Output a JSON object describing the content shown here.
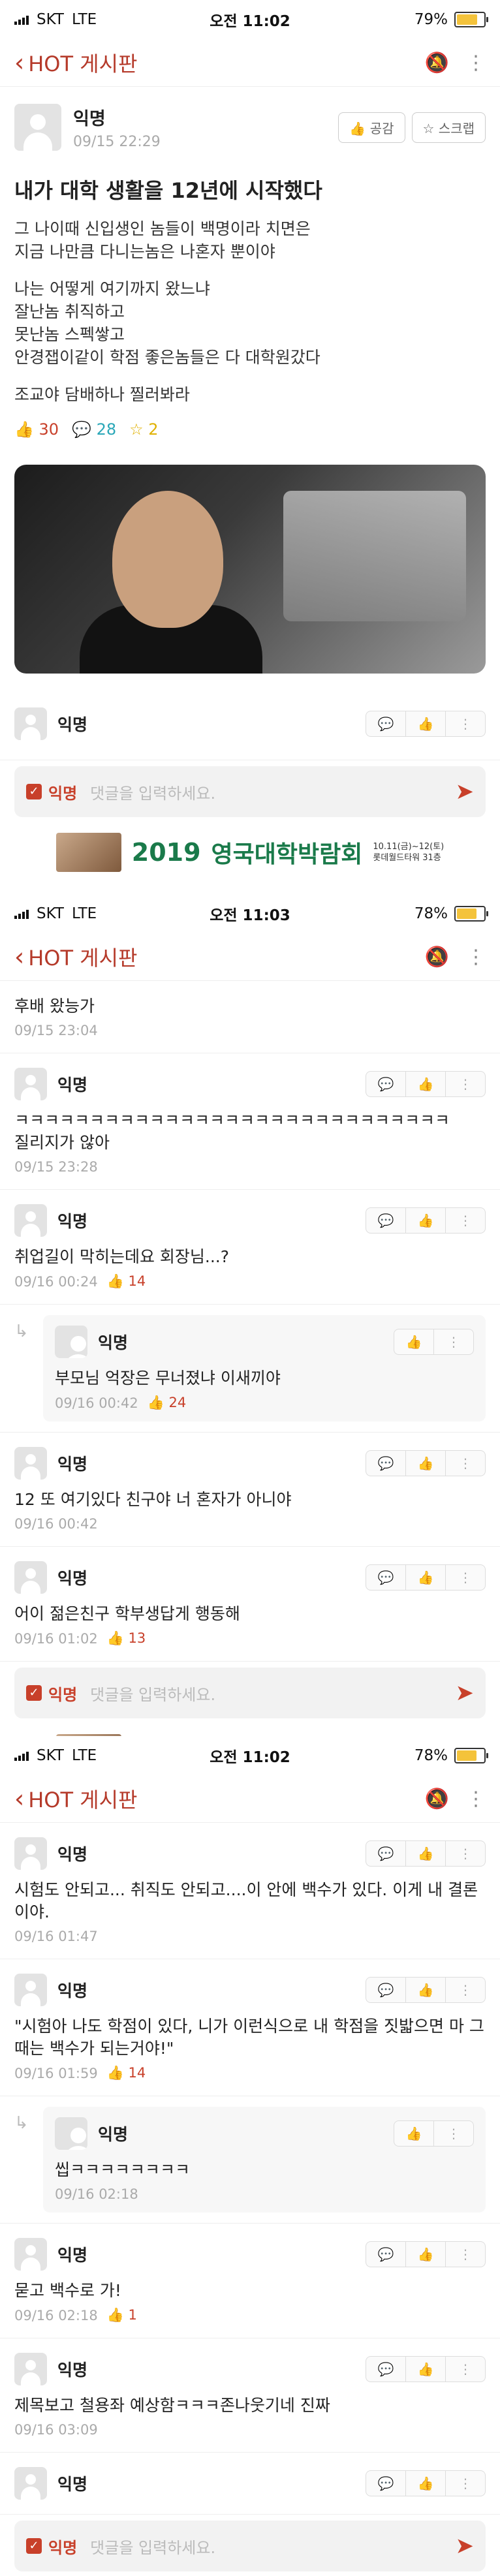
{
  "shots": [
    {
      "status": {
        "carrier": "SKT",
        "network": "LTE",
        "time": "오전 11:02",
        "battery": "79%",
        "battery_level": 0.79
      }
    },
    {
      "status": {
        "carrier": "SKT",
        "network": "LTE",
        "time": "오전 11:03",
        "battery": "78%",
        "battery_level": 0.78
      }
    },
    {
      "status": {
        "carrier": "SKT",
        "network": "LTE",
        "time": "오전 11:02",
        "battery": "78%",
        "battery_level": 0.78
      }
    }
  ],
  "nav": {
    "title": "HOT 게시판",
    "back_icon": "chevron-left-icon",
    "bell_icon": "bell-icon",
    "more_icon": "more-vertical-icon"
  },
  "post": {
    "author": "익명",
    "date": "09/15 22:29",
    "btn_like": "공감",
    "btn_scrap": "스크랩",
    "title": "내가 대학 생활을 12년에 시작했다",
    "paragraphs": [
      "그 나이때 신입생인 놈들이 백명이라 치면은\n지금 나만큼 다니는놈은 나혼자 뿐이야",
      "나는 어떻게 여기까지 왔느냐\n잘난놈 취직하고\n못난놈 스펙쌓고\n안경잽이같이 학점 좋은놈들은 다 대학원갔다",
      "조교야 담배하나 찔러봐라"
    ],
    "likes": "30",
    "comments": "28",
    "scraps": "2"
  },
  "input": {
    "anon": "익명",
    "placeholder": "댓글을 입력하세요."
  },
  "banner": {
    "year": "2019",
    "text": "영국대학박람회",
    "date_line1": "10.11(금)~12(토)",
    "date_line2": "롯데월드타워 31층"
  },
  "comments1": [
    {
      "author": "익명"
    }
  ],
  "comments2": [
    {
      "text": "후배 왔능가",
      "date": "09/15 23:04"
    },
    {
      "author": "익명",
      "text": "ㅋㅋㅋㅋㅋㅋㅋㅋㅋㅋㅋㅋㅋㅋㅋㅋㅋㅋㅋㅋㅋㅋㅋㅋㅋㅋㅋㅋㅋ\n질리지가 않아",
      "date": "09/15 23:28"
    },
    {
      "author": "익명",
      "text": "취업길이 막히는데요 회장님...?",
      "date": "09/16 00:24",
      "likes": "14"
    },
    {
      "author": "익명",
      "text": "부모님 억장은 무너졌냐 이새끼야",
      "date": "09/16 00:42",
      "likes": "24",
      "reply": true
    },
    {
      "author": "익명",
      "text": "12 또 여기있다 친구야 너 혼자가 아니야",
      "date": "09/16 00:42"
    },
    {
      "author": "익명",
      "text": "어이 젊은친구 학부생답게 행동해",
      "date": "09/16 01:02",
      "likes": "13"
    }
  ],
  "comments3": [
    {
      "author": "익명",
      "text": "시험도 안되고... 취직도 안되고....이 안에 백수가 있다. 이게 내 결론이야.",
      "date": "09/16 01:47"
    },
    {
      "author": "익명",
      "text": "\"시험아 나도 학점이 있다,  니가 이런식으로 내 학점을 짓밟으면 마 그때는 백수가 되는거야!\"",
      "date": "09/16 01:59",
      "likes": "14"
    },
    {
      "author": "익명",
      "text": "씹ㅋㅋㅋㅋㅋㅋㅋㅋ",
      "date": "09/16 02:18",
      "reply": true
    },
    {
      "author": "익명",
      "text": "묻고 백수로 가!",
      "date": "09/16 02:18",
      "likes": "1"
    },
    {
      "author": "익명",
      "text": "제목보고 철용좌 예상함ㅋㅋㅋ존나웃기네 진짜",
      "date": "09/16 03:09"
    },
    {
      "author": "익명"
    }
  ]
}
